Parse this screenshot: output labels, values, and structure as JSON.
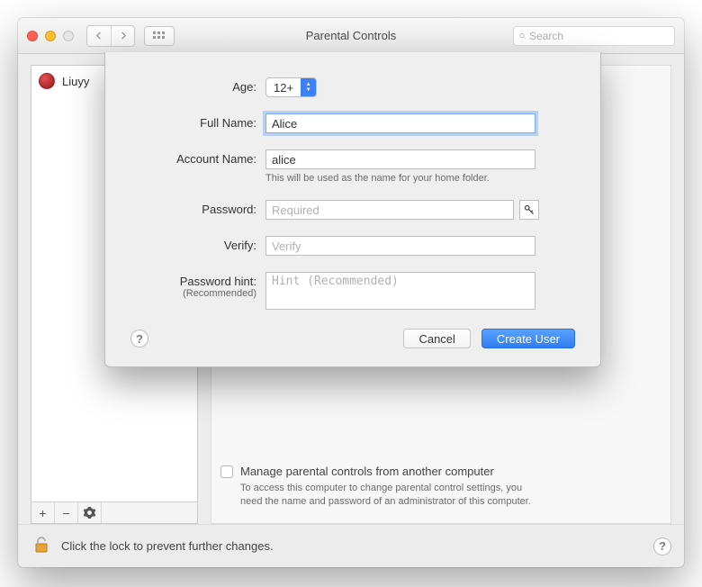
{
  "window": {
    "title": "Parental Controls",
    "search_placeholder": "Search"
  },
  "sidebar": {
    "users": [
      {
        "name": "Liuyy"
      }
    ],
    "footer": {
      "add": "+",
      "remove": "−"
    }
  },
  "content": {
    "manage_remote": {
      "label": "Manage parental controls from another computer",
      "desc": "To access this computer to change parental control settings, you need the name and password of an administrator of this computer."
    }
  },
  "footer": {
    "lock_text": "Click the lock to prevent further changes."
  },
  "sheet": {
    "age": {
      "label": "Age:",
      "value": "12+"
    },
    "full_name": {
      "label": "Full Name:",
      "value": "Alice"
    },
    "account_name": {
      "label": "Account Name:",
      "value": "alice",
      "hint": "This will be used as the name for your home folder."
    },
    "password": {
      "label": "Password:",
      "placeholder": "Required"
    },
    "verify": {
      "label": "Verify:",
      "placeholder": "Verify"
    },
    "hint": {
      "label": "Password hint:",
      "sublabel": "(Recommended)",
      "placeholder": "Hint (Recommended)"
    },
    "buttons": {
      "cancel": "Cancel",
      "create": "Create User"
    },
    "help": "?"
  }
}
